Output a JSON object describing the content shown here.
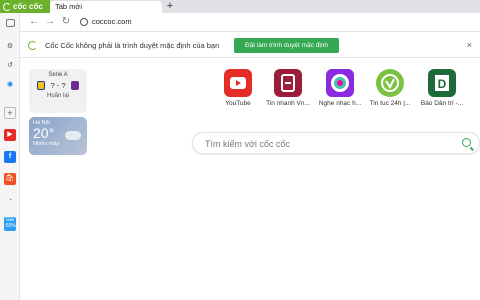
{
  "browser": {
    "brand": "cốc cốc",
    "tab_title": "Tab mới",
    "new_tab": "+",
    "url": "coccoc.com"
  },
  "infobar": {
    "message": "Cốc Cốc không phải là trình duyệt mặc định của bạn",
    "button": "Đặt làm trình duyệt mặc định",
    "close": "×"
  },
  "sidebar": {
    "discount_label": "Giá -50%"
  },
  "widgets": {
    "sport": {
      "league": "Serie A",
      "score": "? - ?",
      "status": "Hoãn lại"
    },
    "weather": {
      "city": "Hà Nội",
      "temp": "20°",
      "condition": "Nhiều mây"
    }
  },
  "speed_dial": [
    {
      "label": "YouTube",
      "color": "#e52d27"
    },
    {
      "label": "Tin nhanh Vn...",
      "color": "#9c1e3c"
    },
    {
      "label": "Nghe nhạc h...",
      "color": "#8a2be2"
    },
    {
      "label": "Tin tuc 24h |...",
      "color": "#7cc242"
    },
    {
      "label": "Báo Dân trí -...",
      "color": "#1e6b3a"
    }
  ],
  "search": {
    "placeholder": "Tìm kiếm với cốc cốc"
  },
  "colors": {
    "brand_green": "#6cb12b",
    "button_green": "#34a853"
  }
}
